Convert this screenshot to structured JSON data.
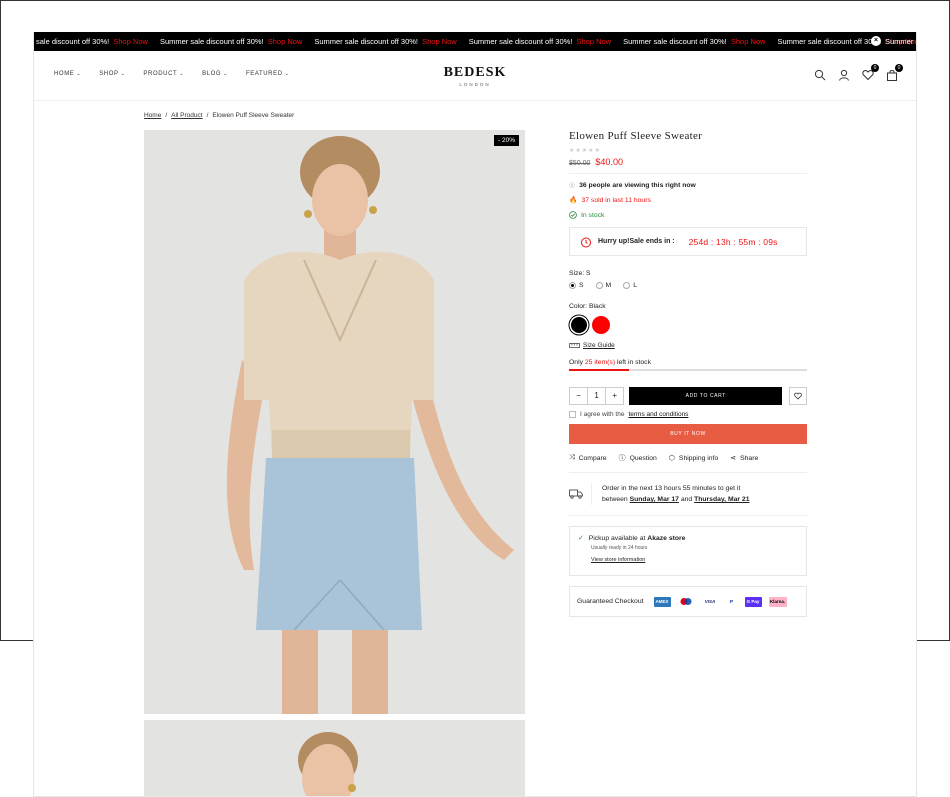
{
  "announcement": {
    "message": "Summer sale discount off 30%!",
    "first_partial": "sale discount off 30%!",
    "link": "Shop Now",
    "tail": "Summer s"
  },
  "nav": {
    "items": [
      "HOME",
      "SHOP",
      "PRODUCT",
      "BLOG",
      "FEATURED"
    ]
  },
  "logo": {
    "name": "BEDESK",
    "sub": "LONDON"
  },
  "header": {
    "wishlist_count": "0",
    "cart_count": "0"
  },
  "breadcrumb": {
    "home": "Home",
    "category": "All Product",
    "current": "Elowen Puff Sleeve Sweater"
  },
  "gallery": {
    "badge": "- 20%"
  },
  "product": {
    "title": "Elowen Puff Sleeve Sweater",
    "stars": "★★★★★",
    "price_old": "$50.00",
    "price_new": "$40.00",
    "viewers": "36 people are viewing this right now",
    "sold": "37 sold in last 11 hours",
    "stock_status": "In stock",
    "hurry_label": "Hurry up!Sale ends in :",
    "timer": "254d : 13h : 55m : 09s",
    "size_label": "Size: S",
    "sizes": [
      "S",
      "M",
      "L"
    ],
    "selected_size": "S",
    "color_label": "Color: Black",
    "size_guide": "Size Guide",
    "stock_prefix": "Only",
    "stock_count": "25 item(s)",
    "stock_suffix": "left in stock",
    "stock_level": 0.25,
    "quantity": "1",
    "add_to_cart": "ADD TO CART",
    "agree_prefix": "I agree with the",
    "terms": "terms and conditions",
    "buy_now": "BUY IT NOW",
    "actions": [
      "Compare",
      "Question",
      "Shipping info",
      "Share"
    ],
    "delivery_line1": "Order in the next 13 hours 55 minutes to get it",
    "delivery_between": "between",
    "delivery_from": "Sunday, Mar 17",
    "delivery_and": "and",
    "delivery_to": "Thursday, Mar 21",
    "pickup_prefix": "Pickup available at",
    "pickup_store": "Akaze store",
    "pickup_ready": "Usually ready in 24 hours",
    "pickup_link": "View store information",
    "checkout_label": "Guaranteed Checkout",
    "payment_methods": [
      "AMEX",
      "MC",
      "VISA",
      "P",
      "G Pay",
      "Klarna."
    ]
  },
  "colors": {
    "accent_red": "#ee1111",
    "buy_now": "#e85c44",
    "swatch_black": "#000000",
    "swatch_red": "#ff0000"
  }
}
